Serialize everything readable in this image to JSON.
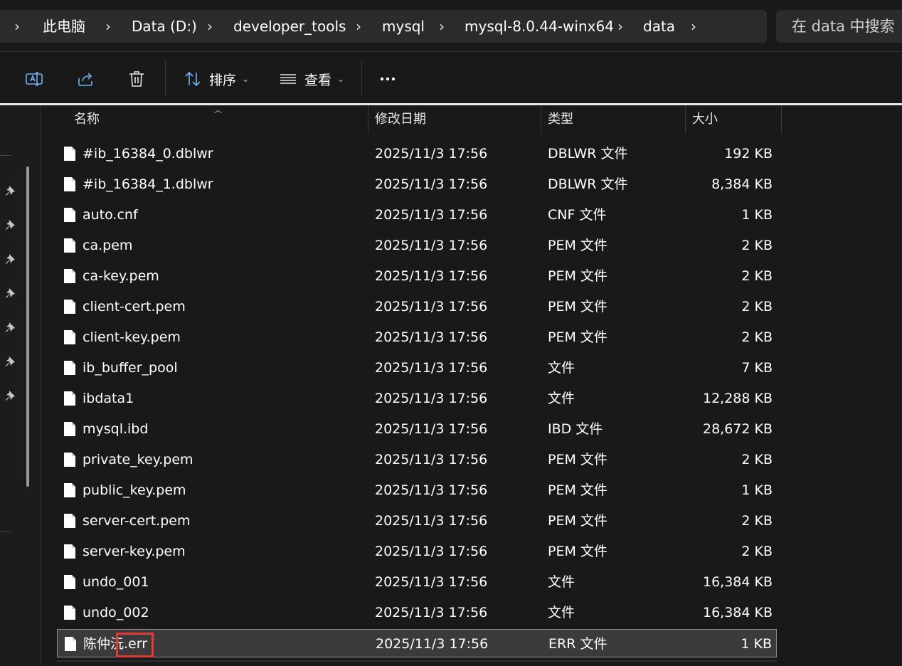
{
  "breadcrumb": {
    "items": [
      "此电脑",
      "Data (D:)",
      "developer_tools",
      "mysql",
      "mysql-8.0.44-winx64",
      "data"
    ]
  },
  "search": {
    "placeholder": "在 data 中搜索"
  },
  "toolbar": {
    "sort_label": "排序",
    "view_label": "查看",
    "icons": [
      "rename-icon",
      "share-icon",
      "delete-icon",
      "sort-icon",
      "view-icon",
      "more-icon"
    ]
  },
  "columns": {
    "name": "名称",
    "date": "修改日期",
    "type": "类型",
    "size": "大小"
  },
  "files": [
    {
      "name": "#ib_16384_0.dblwr",
      "date": "2025/11/3 17:56",
      "type": "DBLWR 文件",
      "size": "192 KB"
    },
    {
      "name": "#ib_16384_1.dblwr",
      "date": "2025/11/3 17:56",
      "type": "DBLWR 文件",
      "size": "8,384 KB"
    },
    {
      "name": "auto.cnf",
      "date": "2025/11/3 17:56",
      "type": "CNF 文件",
      "size": "1 KB"
    },
    {
      "name": "ca.pem",
      "date": "2025/11/3 17:56",
      "type": "PEM 文件",
      "size": "2 KB"
    },
    {
      "name": "ca-key.pem",
      "date": "2025/11/3 17:56",
      "type": "PEM 文件",
      "size": "2 KB"
    },
    {
      "name": "client-cert.pem",
      "date": "2025/11/3 17:56",
      "type": "PEM 文件",
      "size": "2 KB"
    },
    {
      "name": "client-key.pem",
      "date": "2025/11/3 17:56",
      "type": "PEM 文件",
      "size": "2 KB"
    },
    {
      "name": "ib_buffer_pool",
      "date": "2025/11/3 17:56",
      "type": "文件",
      "size": "7 KB"
    },
    {
      "name": "ibdata1",
      "date": "2025/11/3 17:56",
      "type": "文件",
      "size": "12,288 KB"
    },
    {
      "name": "mysql.ibd",
      "date": "2025/11/3 17:56",
      "type": "IBD 文件",
      "size": "28,672 KB"
    },
    {
      "name": "private_key.pem",
      "date": "2025/11/3 17:56",
      "type": "PEM 文件",
      "size": "2 KB"
    },
    {
      "name": "public_key.pem",
      "date": "2025/11/3 17:56",
      "type": "PEM 文件",
      "size": "1 KB"
    },
    {
      "name": "server-cert.pem",
      "date": "2025/11/3 17:56",
      "type": "PEM 文件",
      "size": "2 KB"
    },
    {
      "name": "server-key.pem",
      "date": "2025/11/3 17:56",
      "type": "PEM 文件",
      "size": "2 KB"
    },
    {
      "name": "undo_001",
      "date": "2025/11/3 17:56",
      "type": "文件",
      "size": "16,384 KB"
    },
    {
      "name": "undo_002",
      "date": "2025/11/3 17:56",
      "type": "文件",
      "size": "16,384 KB"
    },
    {
      "name": "陈仲沅.err",
      "date": "2025/11/3 17:56",
      "type": "ERR 文件",
      "size": "1 KB",
      "selected": true
    }
  ],
  "colors": {
    "background": "#191919",
    "bar": "#2b2b2b",
    "selected_row": "#3b3b3b",
    "highlight": "#e53935"
  }
}
